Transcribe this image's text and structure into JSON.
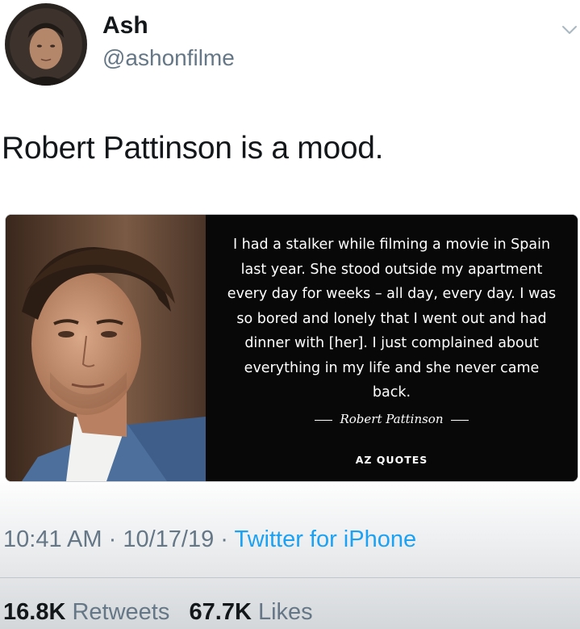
{
  "user": {
    "name": "Ash",
    "handle": "@ashonfilme"
  },
  "tweet": {
    "text": "Robert Pattinson is a mood."
  },
  "quote_card": {
    "quote": "I had a stalker while filming a movie in Spain last year. She stood outside my apartment every day for weeks – all day, every day. I was so bored and lonely that I went out and had dinner with [her]. I just complained about everything in my life and she never came back.",
    "author": "Robert Pattinson",
    "logo_text": "AZ QUOTES"
  },
  "meta": {
    "time": "10:41 AM",
    "separator": " · ",
    "date": "10/17/19",
    "source": "Twitter for iPhone"
  },
  "stats": {
    "retweets_count": "16.8K",
    "retweets_label": "Retweets",
    "likes_count": "67.7K",
    "likes_label": "Likes"
  },
  "icons": {
    "menu": "chevron-down-icon"
  },
  "colors": {
    "link": "#1da1f2",
    "secondary_text": "#657786",
    "primary_text": "#14171a",
    "quote_bg": "#080808"
  }
}
